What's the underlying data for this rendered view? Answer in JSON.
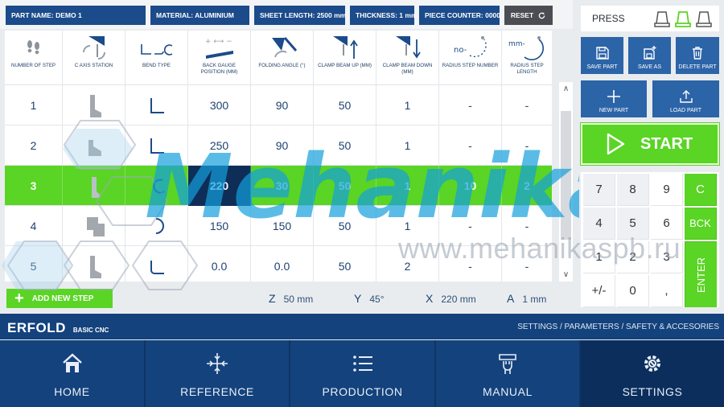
{
  "top_bar": {
    "part_name": "PART NAME:  DEMO 1",
    "material": "MATERIAL:  ALUMINIUM",
    "sheet_length": "SHEET LENGTH:  2500 mm",
    "thickness": "THICKNESS: 1 mm",
    "piece_counter": "PIECE COUNTER: 0000",
    "reset_label": "RESET"
  },
  "table": {
    "headers": [
      {
        "label": "NUMBER OF STEP",
        "icon": "footsteps-icon"
      },
      {
        "label": "C AXIS STATION",
        "icon": "c-axis-icon"
      },
      {
        "label": "BEND TYPE",
        "icon": "bend-type-icon"
      },
      {
        "label": "BACK GAUGE POSITION (mm)",
        "icon": "back-gauge-icon"
      },
      {
        "label": "FOLDING ANGLE (°)",
        "icon": "folding-angle-icon"
      },
      {
        "label": "CLAMP BEAM UP (mm)",
        "icon": "clamp-up-icon"
      },
      {
        "label": "CLAMP BEAM DOWN (mm)",
        "icon": "clamp-down-icon"
      },
      {
        "label": "RADIUS STEP NUMBER",
        "icon": "radius-number-icon"
      },
      {
        "label": "RADIUS STEP LENGTH",
        "icon": "radius-length-icon"
      }
    ],
    "rows": [
      {
        "step": "1",
        "c_axis": "boot",
        "bend": "L",
        "back_gauge": "300",
        "angle": "90",
        "clamp_up": "50",
        "clamp_down": "1",
        "radius_num": "-",
        "radius_len": "-",
        "selected": false
      },
      {
        "step": "2",
        "c_axis": "boot",
        "bend": "L",
        "back_gauge": "250",
        "angle": "90",
        "clamp_up": "50",
        "clamp_down": "1",
        "radius_num": "-",
        "radius_len": "-",
        "selected": false
      },
      {
        "step": "3",
        "c_axis": "boot",
        "bend": "radius",
        "back_gauge": "220",
        "angle": "30",
        "clamp_up": "50",
        "clamp_down": "1",
        "radius_num": "10",
        "radius_len": "2",
        "selected": true
      },
      {
        "step": "4",
        "c_axis": "boot",
        "bend": "radius",
        "back_gauge": "150",
        "angle": "150",
        "clamp_up": "50",
        "clamp_down": "1",
        "radius_num": "-",
        "radius_len": "-",
        "selected": false
      },
      {
        "step": "5",
        "c_axis": "boot",
        "bend": "flat",
        "back_gauge": "0.0",
        "angle": "0.0",
        "clamp_up": "50",
        "clamp_down": "2",
        "radius_num": "-",
        "radius_len": "-",
        "selected": false
      }
    ]
  },
  "add_step_label": "ADD NEW STEP",
  "axes": [
    {
      "label": "Z",
      "value": "50 mm"
    },
    {
      "label": "Y",
      "value": "45°"
    },
    {
      "label": "X",
      "value": "220 mm"
    },
    {
      "label": "A",
      "value": "1 mm"
    }
  ],
  "right_panel": {
    "press_label": "PRESS",
    "save_part": "SAVE PART",
    "save_as": "SAVE AS",
    "delete_part": "DELETE PART",
    "new_part": "NEW PART",
    "load_part": "LOAD PART",
    "start": "START"
  },
  "keypad": {
    "keys": [
      "7",
      "8",
      "9",
      "4",
      "5",
      "6",
      "1",
      "2",
      "3",
      "+/-",
      "0",
      ","
    ],
    "clear": "C",
    "back": "BCK",
    "enter": "ENTER"
  },
  "brand": {
    "logo": "ERFOLD",
    "sub": "BASIC CNC",
    "breadcrumb": "SETTINGS / PARAMETERS / SAFETY & ACCESORIES"
  },
  "nav": [
    {
      "label": "HOME",
      "icon": "home-icon"
    },
    {
      "label": "REFERENCE",
      "icon": "reference-icon"
    },
    {
      "label": "PRODUCTION",
      "icon": "list-icon"
    },
    {
      "label": "MANUAL",
      "icon": "manual-hand-icon"
    },
    {
      "label": "SETTINGS",
      "icon": "gear-icon"
    }
  ],
  "watermark": {
    "brand": "Mehanika",
    "url": "www.mehanikaspb.ru"
  },
  "colors": {
    "primary": "#1b4b8a",
    "accent_green": "#5ad425",
    "nav_bg": "#14427c",
    "nav_active": "#0b2e5d"
  }
}
